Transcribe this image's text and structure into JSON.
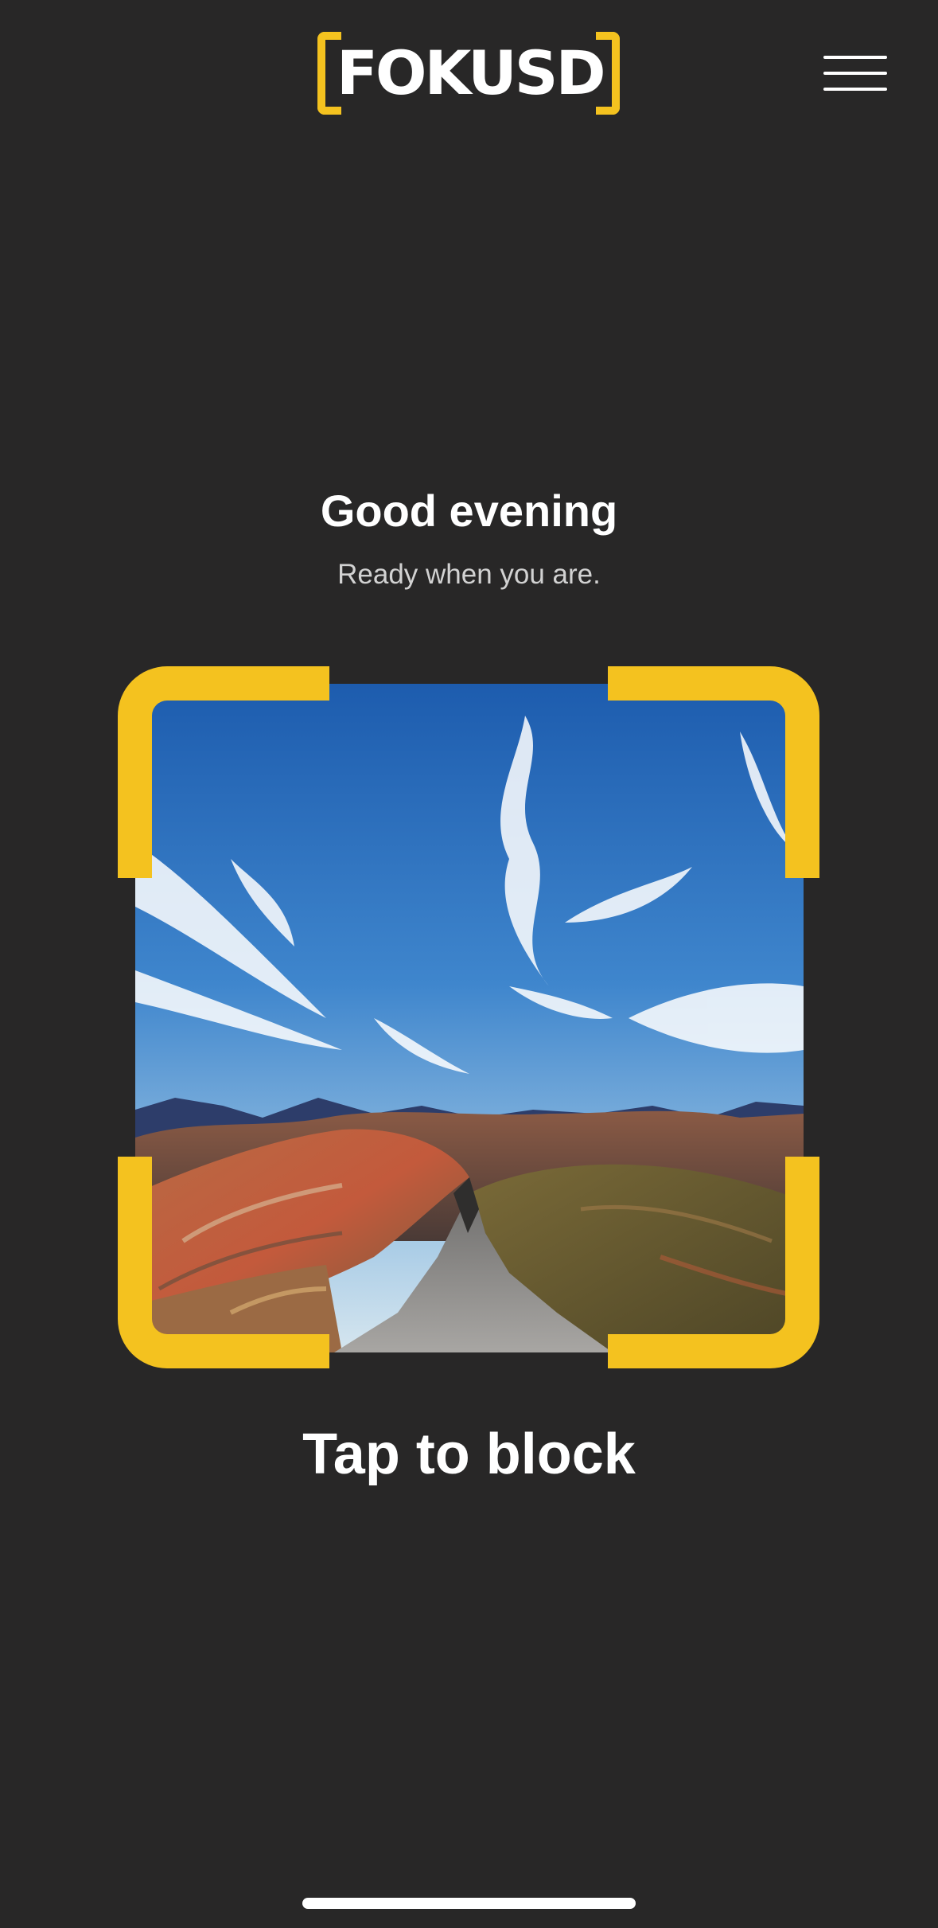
{
  "header": {
    "logo_text": "FOKUSD",
    "menu_icon": "hamburger-menu-icon"
  },
  "main": {
    "greeting": "Good evening",
    "subtitle": "Ready when you are.",
    "focus_frame_image": "mountain-landscape-photo",
    "action_label": "Tap to block"
  },
  "colors": {
    "background": "#282727",
    "accent": "#f4c21f",
    "text": "#ffffff",
    "subtext": "#d2d2d2"
  }
}
